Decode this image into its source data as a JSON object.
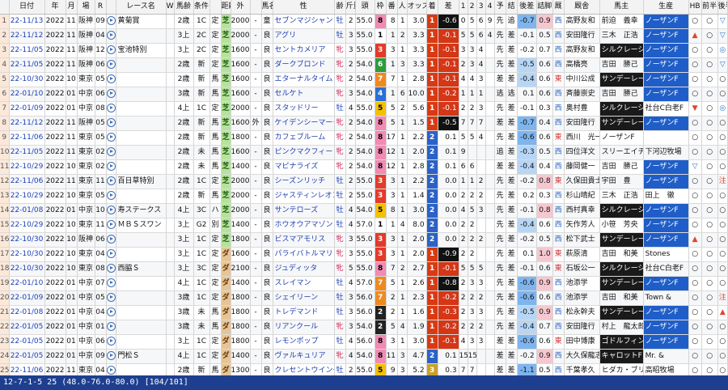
{
  "columns": [
    "",
    "日付",
    "年",
    "月",
    "場",
    "R",
    "",
    "レース名",
    "W",
    "馬齢",
    "条件",
    "",
    "距離",
    "外",
    "",
    "馬名",
    "性",
    "齢",
    "斤量",
    "頭",
    "枠",
    "番",
    "人",
    "オッズ",
    "着",
    "差",
    "1",
    "2",
    "3",
    "4",
    "予",
    "結",
    "後差",
    "詰脚",
    "厩",
    "厩舎",
    "馬主",
    "生産",
    "HB",
    "前半",
    "後半"
  ],
  "rows": [
    [
      "1",
      "22-11/13",
      "2022",
      "11",
      "阪神",
      "09",
      "",
      "黄菊賞",
      "",
      "2歳",
      "1C",
      "定",
      "芝",
      "2000",
      "-",
      "童",
      "セブンマジシャン",
      "牡",
      "2",
      "55.0",
      "8",
      "8",
      "1",
      "3.0",
      "1",
      "-0.6",
      "0",
      "5",
      "6",
      "9",
      "先",
      "追",
      "-0.7",
      "0.9",
      "西",
      "高野友和",
      "前迫　義幸",
      "ノーザンF",
      "○",
      "○",
      "▽"
    ],
    [
      "2",
      "22-11/12",
      "2022",
      "11",
      "阪神",
      "04",
      "",
      "",
      "",
      "3上",
      "2C",
      "定",
      "芝",
      "2000",
      "-",
      "良",
      "アグリ",
      "牡",
      "3",
      "55.0",
      "1",
      "1",
      "2",
      "3.3",
      "1",
      "-0.1",
      "5",
      "5",
      "6",
      "4",
      "先",
      "差",
      "-0.1",
      "0.5",
      "西",
      "安田隆行",
      "三木　正浩",
      "ノーザンF",
      "▲",
      "○",
      "▽"
    ],
    [
      "3",
      "22-11/05",
      "2022",
      "11",
      "阪神",
      "12",
      "",
      "宝池特別",
      "",
      "3上",
      "2C",
      "定",
      "芝",
      "1600",
      "-",
      "良",
      "セントカメリア",
      "牝",
      "3",
      "55.0",
      "3",
      "3",
      "1",
      "3.3",
      "1",
      "-0.1",
      "3",
      "3",
      "4",
      "",
      "先",
      "差",
      "-0.2",
      "0.7",
      "西",
      "高野友和",
      "シルクレーシ",
      "ノーザンF",
      "○",
      "○",
      "◎"
    ],
    [
      "4",
      "22-11/05",
      "2022",
      "11",
      "阪神",
      "06",
      "",
      "",
      "",
      "2歳",
      "新",
      "定",
      "芝",
      "1600",
      "-",
      "良",
      "ダークブロンド",
      "牝",
      "2",
      "54.0",
      "6",
      "1",
      "3",
      "3.3",
      "1",
      "-0.1",
      "2",
      "3",
      "4",
      "",
      "先",
      "差",
      "-0.5",
      "0.6",
      "西",
      "高橋亮",
      "吉田　勝己",
      "ノーザンF",
      "○",
      "○",
      "▽"
    ],
    [
      "5",
      "22-10/30",
      "2022",
      "10",
      "東京",
      "05",
      "",
      "",
      "",
      "2歳",
      "新",
      "馬",
      "芝",
      "1600",
      "-",
      "良",
      "エターナルタイム",
      "牝",
      "2",
      "54.0",
      "7",
      "7",
      "1",
      "2.8",
      "1",
      "-0.1",
      "4",
      "4",
      "3",
      "",
      "差",
      "差",
      "-0.4",
      "0.6",
      "東",
      "中川公成",
      "サンデーレー",
      "ノーザンF",
      "○",
      "○",
      "○"
    ],
    [
      "6",
      "22-01/10",
      "2022",
      "01",
      "中京",
      "06",
      "",
      "",
      "",
      "3歳",
      "新",
      "馬",
      "芝",
      "1600",
      "-",
      "良",
      "セルケト",
      "牝",
      "3",
      "54.0",
      "4",
      "1",
      "6",
      "10.0",
      "1",
      "-0.2",
      "1",
      "1",
      "1",
      "",
      "逃",
      "逃",
      "0.1",
      "0.6",
      "西",
      "斉藤崇史",
      "吉田　勝己",
      "ノーザンF",
      "○",
      "○",
      "○"
    ],
    [
      "7",
      "22-01/09",
      "2022",
      "01",
      "中京",
      "08",
      "",
      "",
      "",
      "4上",
      "1C",
      "定",
      "芝",
      "2000",
      "-",
      "良",
      "スタッドリー",
      "牡",
      "4",
      "55.0",
      "5",
      "5",
      "2",
      "5.6",
      "1",
      "-0.1",
      "2",
      "2",
      "3",
      "",
      "先",
      "差",
      "-0.1",
      "0.3",
      "西",
      "奥村豊",
      "シルクレーシ",
      "社台C白老F",
      "▼",
      "○",
      "◎"
    ],
    [
      "8",
      "22-11/12",
      "2022",
      "11",
      "阪神",
      "05",
      "",
      "",
      "",
      "2歳",
      "新",
      "馬",
      "芝",
      "1600",
      "外",
      "良",
      "ケイデンシーマーク",
      "牝",
      "2",
      "54.0",
      "8",
      "5",
      "1",
      "1.5",
      "1",
      "-0.5",
      "7",
      "7",
      "7",
      "",
      "差",
      "差",
      "-0.7",
      "0.4",
      "西",
      "安田隆行",
      "サンデーレー",
      "ノーザンF",
      "○",
      "○",
      "○"
    ],
    [
      "9",
      "22-11/06",
      "2022",
      "11",
      "東京",
      "05",
      "",
      "",
      "",
      "2歳",
      "新",
      "馬",
      "芝",
      "1800",
      "-",
      "良",
      "カフェブルーム",
      "牝",
      "2",
      "54.0",
      "8",
      "17",
      "1",
      "2.2",
      "2",
      "0.1",
      "5",
      "5",
      "4",
      "",
      "先",
      "差",
      "-0.6",
      "0.6",
      "東",
      "西川　光一",
      "ノーザンF",
      "",
      "○",
      "○",
      "○"
    ],
    [
      "10",
      "22-11/05",
      "2022",
      "11",
      "東京",
      "02",
      "",
      "",
      "",
      "2歳",
      "未",
      "馬",
      "芝",
      "1600",
      "-",
      "良",
      "ピンクマクフィー",
      "牝",
      "2",
      "54.0",
      "8",
      "12",
      "1",
      "2.0",
      "2",
      "0.1",
      "9",
      "",
      "",
      "",
      "追",
      "差",
      "-0.3",
      "0.5",
      "西",
      "四位洋文",
      "スリーエイチ",
      "下河辺牧場",
      "○",
      "○",
      "○"
    ],
    [
      "11",
      "22-10/29",
      "2022",
      "10",
      "東京",
      "02",
      "",
      "",
      "",
      "2歳",
      "未",
      "馬",
      "芝",
      "1400",
      "-",
      "良",
      "マピナライズ",
      "牝",
      "2",
      "54.0",
      "8",
      "12",
      "1",
      "2.8",
      "2",
      "0.1",
      "6",
      "6",
      "",
      "",
      "差",
      "差",
      "-0.4",
      "0.4",
      "西",
      "藤岡健一",
      "吉田　勝己",
      "ノーザンF",
      "▽",
      "○",
      "○"
    ],
    [
      "12",
      "22-11/06",
      "2022",
      "11",
      "東京",
      "11",
      "",
      "百日草特別",
      "",
      "2歳",
      "1C",
      "定",
      "芝",
      "2000",
      "-",
      "良",
      "シーズンリッチ",
      "牡",
      "2",
      "55.0",
      "3",
      "3",
      "1",
      "2.2",
      "2",
      "0.0",
      "1",
      "1",
      "2",
      "",
      "先",
      "差",
      "-0.2",
      "0.8",
      "東",
      "久保田貴士",
      "宇田　豊",
      "ノーザンF",
      "○",
      "○",
      "注"
    ],
    [
      "13",
      "22-10/29",
      "2022",
      "10",
      "東京",
      "05",
      "",
      "",
      "",
      "2歳",
      "新",
      "馬",
      "芝",
      "2000",
      "-",
      "良",
      "ジャスティンレオン",
      "牡",
      "2",
      "55.0",
      "3",
      "3",
      "1",
      "1.4",
      "2",
      "0.0",
      "2",
      "2",
      "2",
      "",
      "先",
      "差",
      "0.2",
      "0.3",
      "西",
      "杉山晴紀",
      "三木　正浩",
      "田上　徹",
      "○",
      "○",
      "○"
    ],
    [
      "14",
      "22-01/08",
      "2022",
      "01",
      "中京",
      "10",
      "",
      "寿ステークス",
      "",
      "4上",
      "3C",
      "ハ",
      "芝",
      "2000",
      "-",
      "良",
      "サンテローズ",
      "牡",
      "4",
      "54.0",
      "5",
      "8",
      "1",
      "3.0",
      "2",
      "0.0",
      "4",
      "5",
      "3",
      "",
      "先",
      "差",
      "-0.1",
      "0.8",
      "西",
      "西村真幸",
      "シルクレーシ",
      "ノーザンF",
      "○",
      "○",
      "○"
    ],
    [
      "15",
      "22-10/29",
      "2022",
      "10",
      "東京",
      "11",
      "",
      "ＭＢＳスワン",
      "",
      "3上",
      "G2",
      "別",
      "芝",
      "1400",
      "-",
      "良",
      "ホウオウアマゾン",
      "牡",
      "4",
      "57.0",
      "1",
      "1",
      "4",
      "8.0",
      "2",
      "0.0",
      "2",
      "2",
      "",
      "",
      "先",
      "差",
      "-0.4",
      "0.6",
      "西",
      "矢作芳人",
      "小笹　芳央",
      "ノーザンF",
      "○",
      "○",
      "○"
    ],
    [
      "16",
      "22-10/30",
      "2022",
      "10",
      "阪神",
      "06",
      "",
      "",
      "",
      "3上",
      "1C",
      "定",
      "芝",
      "1800",
      "-",
      "良",
      "ビスマアモリス",
      "牝",
      "3",
      "55.0",
      "3",
      "3",
      "1",
      "2.0",
      "2",
      "0.0",
      "2",
      "2",
      "2",
      "",
      "先",
      "差",
      "-0.2",
      "0.5",
      "西",
      "松下武士",
      "サンデーレー",
      "ノーザンF",
      "▲",
      "○",
      "○"
    ],
    [
      "17",
      "22-10/30",
      "2022",
      "10",
      "東京",
      "04",
      "",
      "",
      "",
      "3上",
      "1C",
      "定",
      "ダ",
      "1600",
      "-",
      "良",
      "パライバトルマリン",
      "牝",
      "3",
      "55.0",
      "3",
      "3",
      "1",
      "2.0",
      "1",
      "-0.9",
      "2",
      "2",
      "",
      "",
      "先",
      "差",
      "0.1",
      "1.0",
      "東",
      "萩原清",
      "吉田　和美",
      "Stones",
      "○",
      "○",
      "○"
    ],
    [
      "18",
      "22-10/30",
      "2022",
      "10",
      "東京",
      "08",
      "",
      "西脇Ｓ",
      "",
      "3上",
      "3C",
      "定",
      "ダ",
      "2100",
      "-",
      "良",
      "ジュディッタ",
      "牝",
      "5",
      "55.0",
      "8",
      "7",
      "2",
      "2.7",
      "1",
      "-0.1",
      "5",
      "5",
      "5",
      "",
      "先",
      "差",
      "-0.1",
      "0.6",
      "東",
      "石坂公一",
      "シルクレーシ",
      "社台C白老F",
      "○",
      "○",
      "○"
    ],
    [
      "19",
      "22-01/10",
      "2022",
      "01",
      "中京",
      "07",
      "",
      "",
      "",
      "4上",
      "1C",
      "定",
      "ダ",
      "1400",
      "-",
      "良",
      "スレイマン",
      "牡",
      "4",
      "57.0",
      "7",
      "5",
      "1",
      "2.6",
      "1",
      "-0.8",
      "2",
      "3",
      "3",
      "",
      "先",
      "差",
      "-0.6",
      "0.9",
      "西",
      "池添学",
      "サンデーレー",
      "ノーザンF",
      "○",
      "○",
      "○"
    ],
    [
      "20",
      "22-01/09",
      "2022",
      "01",
      "中京",
      "05",
      "",
      "",
      "",
      "3歳",
      "1C",
      "定",
      "ダ",
      "1800",
      "-",
      "良",
      "シェイリーン",
      "牡",
      "3",
      "56.0",
      "7",
      "2",
      "1",
      "2.3",
      "1",
      "-0.2",
      "2",
      "2",
      "2",
      "",
      "先",
      "差",
      "-0.6",
      "0.6",
      "西",
      "池添学",
      "吉田　和美",
      "Town &",
      "○",
      "○",
      "注"
    ],
    [
      "21",
      "22-01/08",
      "2022",
      "01",
      "中京",
      "04",
      "",
      "",
      "",
      "3歳",
      "未",
      "馬",
      "ダ",
      "1800",
      "-",
      "良",
      "トレデマンド",
      "牡",
      "3",
      "56.0",
      "2",
      "2",
      "1",
      "1.6",
      "1",
      "-0.3",
      "2",
      "3",
      "3",
      "",
      "先",
      "差",
      "-0.5",
      "0.9",
      "西",
      "松永幹夫",
      "サンデーレー",
      "ノーザンF",
      "○",
      "○",
      "▲"
    ],
    [
      "22",
      "22-01/05",
      "2022",
      "01",
      "中京",
      "01",
      "",
      "",
      "",
      "3歳",
      "未",
      "馬",
      "ダ",
      "1800",
      "-",
      "良",
      "リアンクール",
      "牝",
      "3",
      "54.0",
      "2",
      "5",
      "4",
      "1.9",
      "1",
      "-0.2",
      "2",
      "2",
      "2",
      "",
      "先",
      "差",
      "-0.4",
      "0.7",
      "西",
      "安田隆行",
      "村上　龍太郎",
      "ノーザンF",
      "○",
      "○",
      "○"
    ],
    [
      "23",
      "22-01/05",
      "2022",
      "01",
      "中京",
      "06",
      "",
      "",
      "",
      "3上",
      "1C",
      "定",
      "ダ",
      "1800",
      "-",
      "良",
      "レモンポップ",
      "牡",
      "4",
      "56.0",
      "8",
      "3",
      "1",
      "3.0",
      "1",
      "-0.1",
      "4",
      "3",
      "3",
      "",
      "差",
      "差",
      "-0.6",
      "0.6",
      "東",
      "田中博康",
      "ゴドルフィン",
      "ノーザンF",
      "○",
      "○",
      "○"
    ],
    [
      "24",
      "22-01/05",
      "2022",
      "01",
      "中京",
      "09",
      "",
      "門松Ｓ",
      "",
      "4上",
      "1C",
      "定",
      "ダ",
      "1400",
      "-",
      "良",
      "ヴァルキュリア",
      "牝",
      "4",
      "54.0",
      "8",
      "11",
      "3",
      "4.7",
      "2",
      "0.1",
      "15",
      "15",
      "",
      "",
      "差",
      "差",
      "-0.2",
      "0.9",
      "西",
      "大久保龍志",
      "キャロットF",
      "Mr. &",
      "○",
      "○",
      "○"
    ],
    [
      "25",
      "22-11/06",
      "2022",
      "11",
      "東京",
      "04",
      "",
      "",
      "",
      "2歳",
      "新",
      "馬",
      "ダ",
      "1300",
      "-",
      "良",
      "クレセントウイング",
      "牡",
      "2",
      "55.0",
      "5",
      "9",
      "3",
      "5.2",
      "3",
      "0.3",
      "7",
      "7",
      "",
      "",
      "差",
      "差",
      "-1.1",
      "0.5",
      "西",
      "千葉孝久",
      "ヒダカ・ブリ",
      "高昭牧場",
      "○",
      "○",
      "○"
    ]
  ],
  "frame_colors": {
    "1": "#ffffff",
    "2": "#222222",
    "3": "#e33b2b",
    "4": "#2a6fd8",
    "5": "#f2c200",
    "6": "#2e9b3c",
    "7": "#f08a1e",
    "8": "#f28ab4"
  },
  "status_bar": "12-7-1-5 25 (48.0-76.0-80.0) [104/101]"
}
